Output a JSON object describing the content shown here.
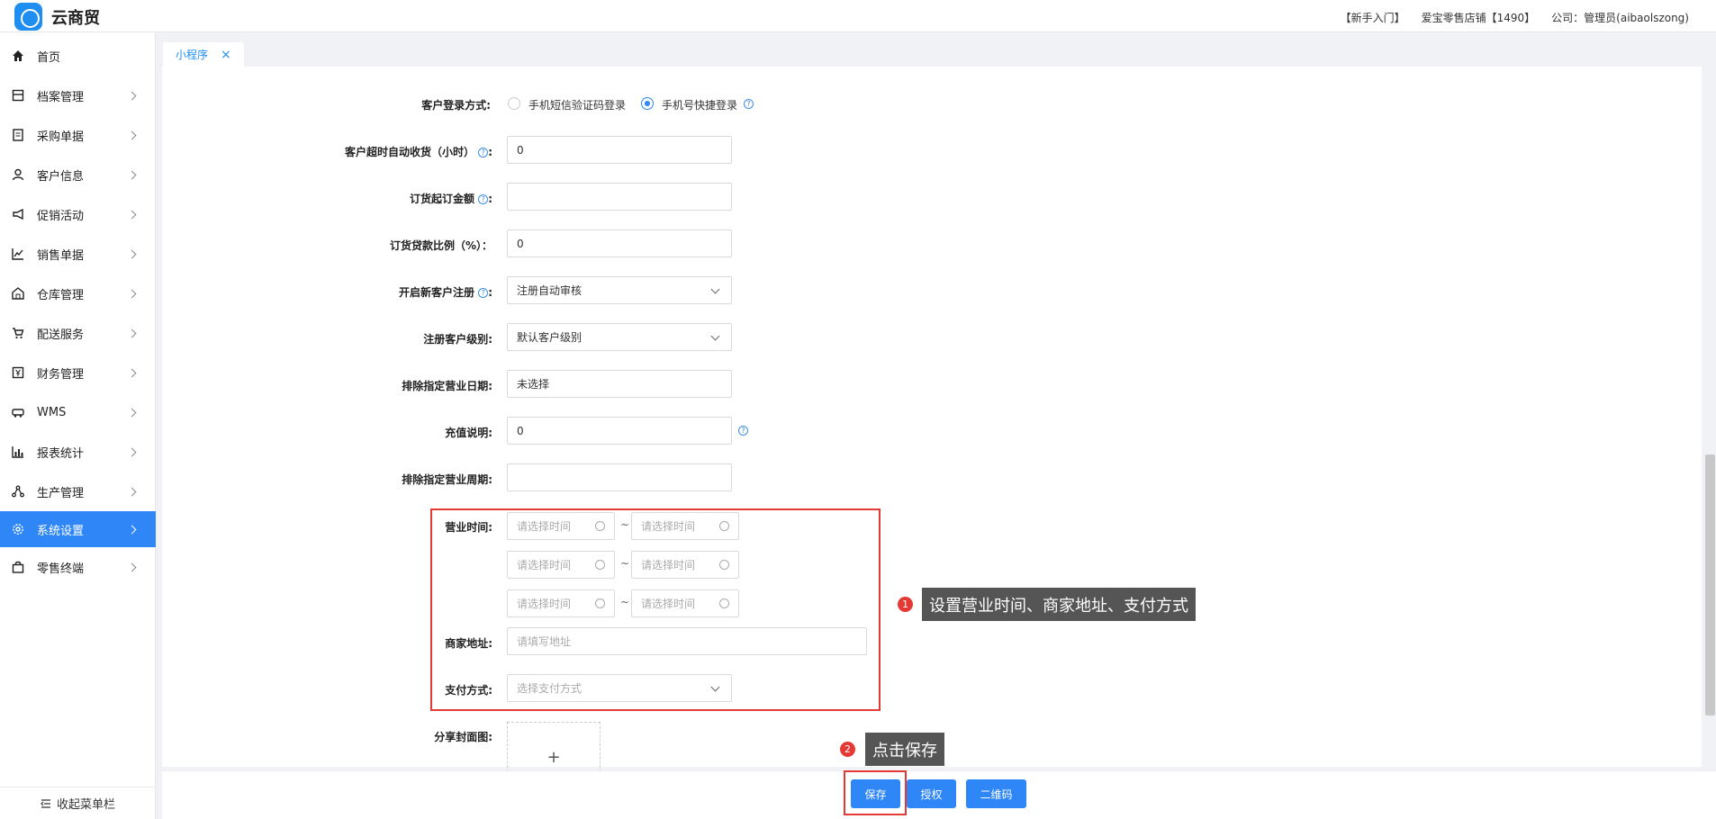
{
  "app": {
    "title": "云商贸"
  },
  "header_links": [
    "【新手入门】",
    "爱宝零售店铺【1490】",
    "公司：管理员(aibaolszong)"
  ],
  "sidebar": {
    "items": [
      {
        "label": "首页",
        "icon": "home-icon"
      },
      {
        "label": "档案管理",
        "icon": "archive-icon"
      },
      {
        "label": "采购单据",
        "icon": "document-icon"
      },
      {
        "label": "客户信息",
        "icon": "user-icon"
      },
      {
        "label": "促销活动",
        "icon": "megaphone-icon"
      },
      {
        "label": "销售单据",
        "icon": "chart-line-icon"
      },
      {
        "label": "仓库管理",
        "icon": "warehouse-icon"
      },
      {
        "label": "配送服务",
        "icon": "cart-icon"
      },
      {
        "label": "财务管理",
        "icon": "yen-icon"
      },
      {
        "label": "WMS",
        "icon": "truck-icon"
      },
      {
        "label": "报表统计",
        "icon": "bar-chart-icon"
      },
      {
        "label": "生产管理",
        "icon": "network-icon"
      },
      {
        "label": "系统设置",
        "icon": "gear-icon"
      },
      {
        "label": "零售终端",
        "icon": "bag-icon"
      }
    ],
    "active": "系统设置",
    "collapse_label": "收起菜单栏"
  },
  "tabs": [
    {
      "label": "小程序",
      "close": "×"
    }
  ],
  "form": {
    "login_label": "客户登录方式:",
    "login_options": [
      "手机短信验证码登录",
      "手机号快捷登录"
    ],
    "login_selected": "手机号快捷登录",
    "auto_receive_label": "客户超时自动收货（小时）",
    "auto_receive_value": "0",
    "min_order_label": "订货起订金额",
    "min_order_value": "",
    "credit_ratio_label": "订货贷款比例（%）：",
    "credit_ratio_value": "0",
    "new_customer_label": "开启新客户注册",
    "new_customer_value": "注册自动审核",
    "customer_level_label": "注册客户级别:",
    "customer_level_value": "默认客户级别",
    "exclude_date_label": "排除指定营业日期:",
    "exclude_date_value": "未选择",
    "recharge_label": "充值说明:",
    "recharge_value": "0",
    "exclude_cycle_label": "排除指定营业周期:",
    "exclude_cycle_value": "",
    "business_hours_label": "营业时间:",
    "time_placeholder": "请选择时间",
    "tilde": "~",
    "address_label": "商家地址:",
    "address_placeholder": "请填写地址",
    "payment_label": "支付方式:",
    "payment_placeholder": "选择支付方式",
    "share_cover_label": "分享封面图:",
    "upload_plus": "+",
    "colon": ":"
  },
  "callouts": [
    {
      "num": "1",
      "text": "设置营业时间、商家地址、支付方式"
    },
    {
      "num": "2",
      "text": "点击保存"
    }
  ],
  "footer": {
    "save": "保存",
    "authorize": "授权",
    "qrcode": "二维码"
  },
  "colors": {
    "primary": "#2e86f7",
    "highlight": "#e53935",
    "callout_bg": "#555555"
  }
}
